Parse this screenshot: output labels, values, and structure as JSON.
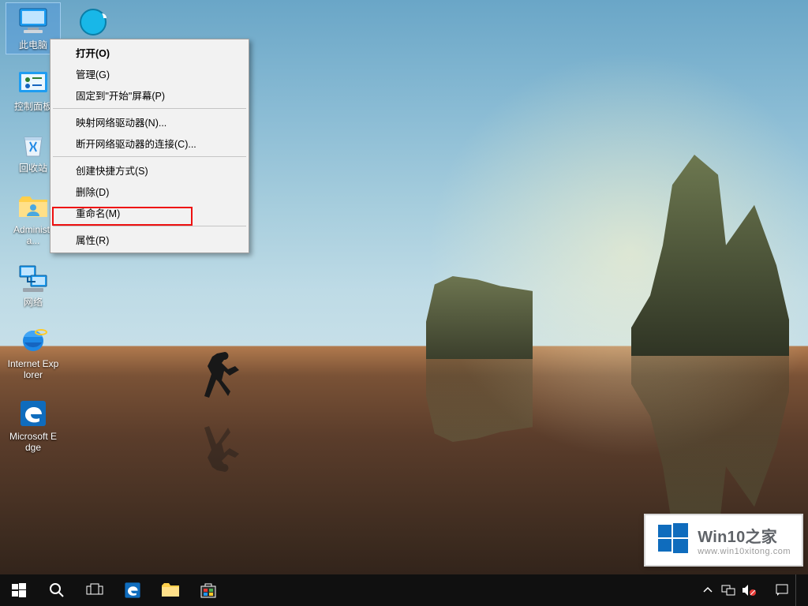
{
  "desktop_icons": [
    {
      "id": "this-pc",
      "label": "此电脑",
      "selected": true
    },
    {
      "id": "control-panel",
      "label": "控制面板",
      "selected": false
    },
    {
      "id": "recycle-bin",
      "label": "回收站",
      "selected": false
    },
    {
      "id": "administrator",
      "label": "Administra...",
      "selected": false
    },
    {
      "id": "network",
      "label": "网络",
      "selected": false
    },
    {
      "id": "internet-explorer",
      "label": "Internet Explorer",
      "selected": false
    },
    {
      "id": "microsoft-edge",
      "label": "Microsoft Edge",
      "selected": false
    }
  ],
  "secondary_icon": {
    "id": "qq-browser",
    "label": ""
  },
  "context_menu": {
    "groups": [
      [
        {
          "label": "打开(O)",
          "bold": true
        },
        {
          "label": "管理(G)"
        },
        {
          "label": "固定到\"开始\"屏幕(P)"
        }
      ],
      [
        {
          "label": "映射网络驱动器(N)..."
        },
        {
          "label": "断开网络驱动器的连接(C)..."
        }
      ],
      [
        {
          "label": "创建快捷方式(S)"
        },
        {
          "label": "删除(D)"
        },
        {
          "label": "重命名(M)"
        }
      ],
      [
        {
          "label": "属性(R)",
          "highlighted": true
        }
      ]
    ]
  },
  "taskbar": {
    "buttons": [
      "start",
      "search",
      "task-view",
      "edge",
      "file-explorer",
      "store"
    ]
  },
  "tray": {
    "items": [
      "chevron-up",
      "network-icon",
      "volume-muted-icon",
      "ime-icon",
      "clock",
      "action-center"
    ]
  },
  "watermark": {
    "title": "Win10之家",
    "subtitle": "www.win10xitong.com"
  }
}
